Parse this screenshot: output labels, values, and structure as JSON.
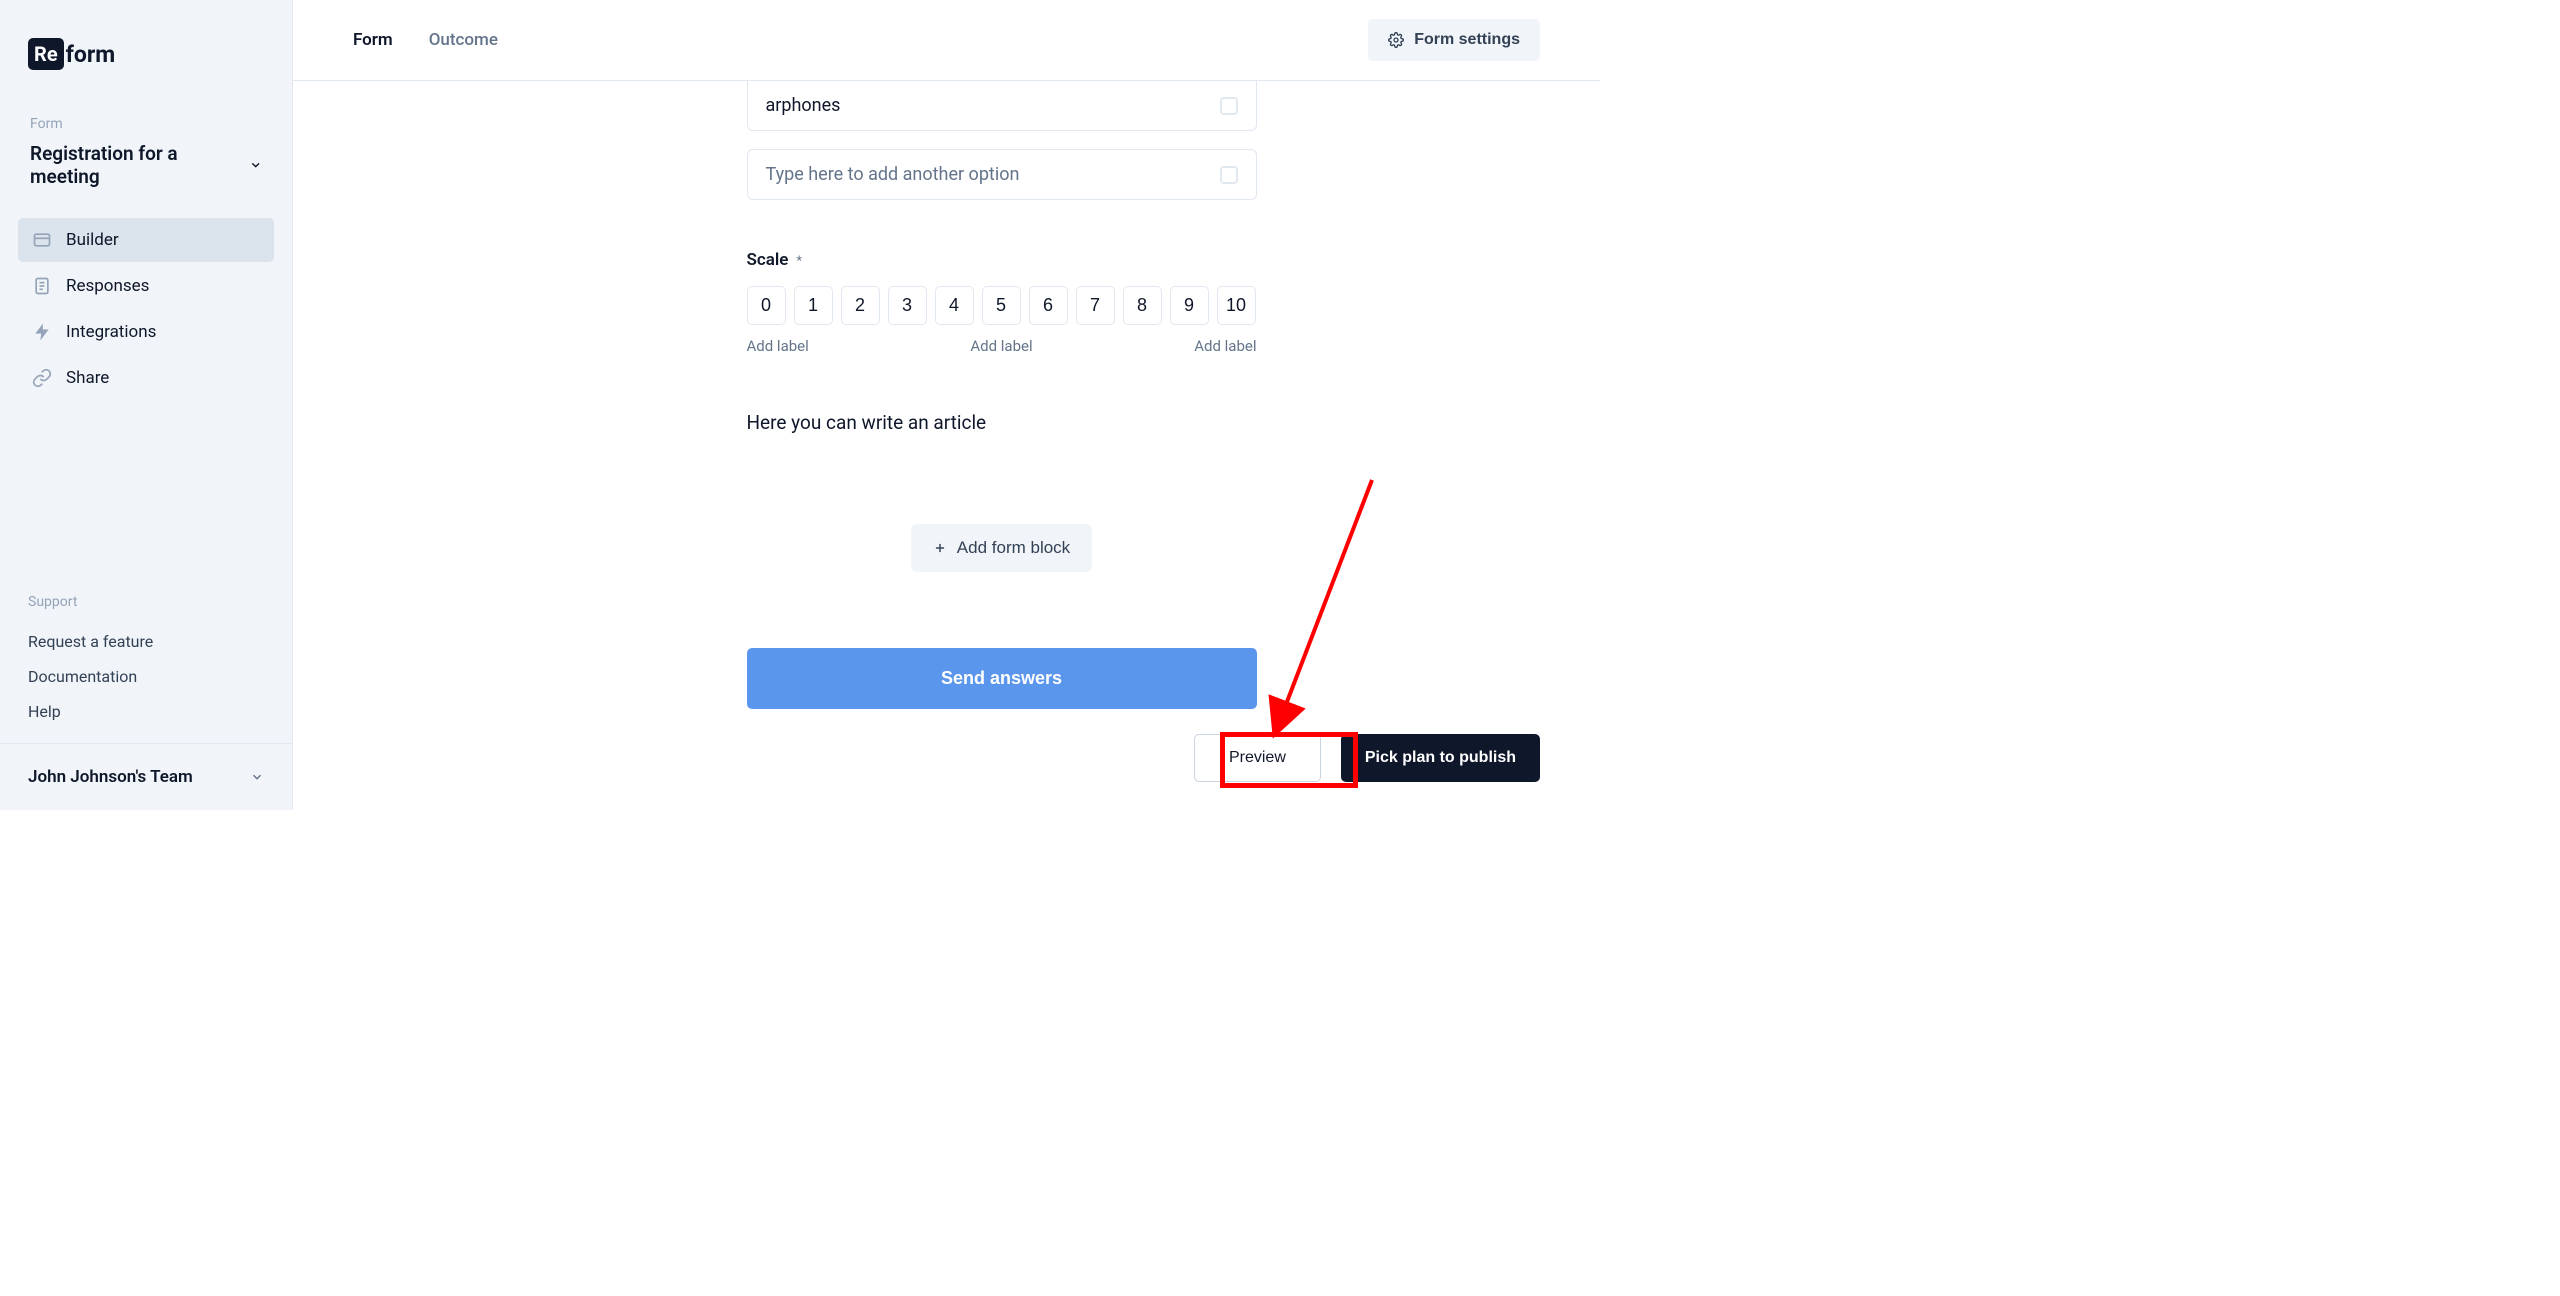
{
  "logo": {
    "prefix": "Re",
    "suffix": "form"
  },
  "sidebar": {
    "section_label": "Form",
    "form_name": "Registration for a meeting",
    "items": [
      {
        "label": "Builder"
      },
      {
        "label": "Responses"
      },
      {
        "label": "Integrations"
      },
      {
        "label": "Share"
      }
    ],
    "support": {
      "label": "Support",
      "links": [
        {
          "label": "Request a feature"
        },
        {
          "label": "Documentation"
        },
        {
          "label": "Help"
        }
      ]
    },
    "team": "John Johnson's Team"
  },
  "topbar": {
    "tabs": [
      {
        "label": "Form"
      },
      {
        "label": "Outcome"
      }
    ],
    "settings_label": "Form settings"
  },
  "canvas": {
    "option_value": "arphones",
    "option_placeholder": "Type here to add another option",
    "scale": {
      "label": "Scale",
      "values": [
        "0",
        "1",
        "2",
        "3",
        "4",
        "5",
        "6",
        "7",
        "8",
        "9",
        "10"
      ],
      "add_label": "Add label"
    },
    "article_text": "Here you can write an article",
    "add_block": "Add form block",
    "send": "Send answers"
  },
  "bottom": {
    "preview": "Preview",
    "publish": "Pick plan to publish"
  }
}
